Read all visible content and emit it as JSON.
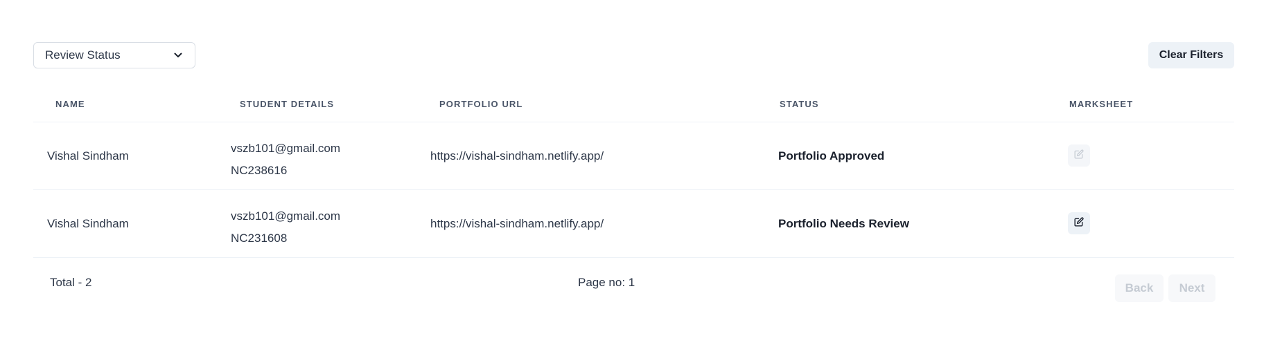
{
  "filters": {
    "review_status": {
      "selected": "Review Status",
      "icon": "chevron-down-icon"
    },
    "clear_label": "Clear Filters"
  },
  "table": {
    "columns": [
      "Name",
      "Student Details",
      "Portfolio URL",
      "Status",
      "Marksheet"
    ],
    "rows": [
      {
        "name": "Vishal Sindham",
        "email": "vszb101@gmail.com",
        "id": "NC238616",
        "portfolio_url": "https://vishal-sindham.netlify.app/",
        "status": "Portfolio Approved",
        "marksheet_icon": "edit-icon",
        "marksheet_enabled": false
      },
      {
        "name": "Vishal Sindham",
        "email": "vszb101@gmail.com",
        "id": "NC231608",
        "portfolio_url": "https://vishal-sindham.netlify.app/",
        "status": "Portfolio Needs Review",
        "marksheet_icon": "edit-icon",
        "marksheet_enabled": true
      }
    ]
  },
  "footer": {
    "total": "Total - 2",
    "page": "Page no: 1",
    "back_label": "Back",
    "next_label": "Next"
  },
  "colors": {
    "text": "#2d3748",
    "muted_button_bg": "#edf2f7",
    "disabled_text": "#c5cbd3",
    "border": "#edf2f7"
  }
}
